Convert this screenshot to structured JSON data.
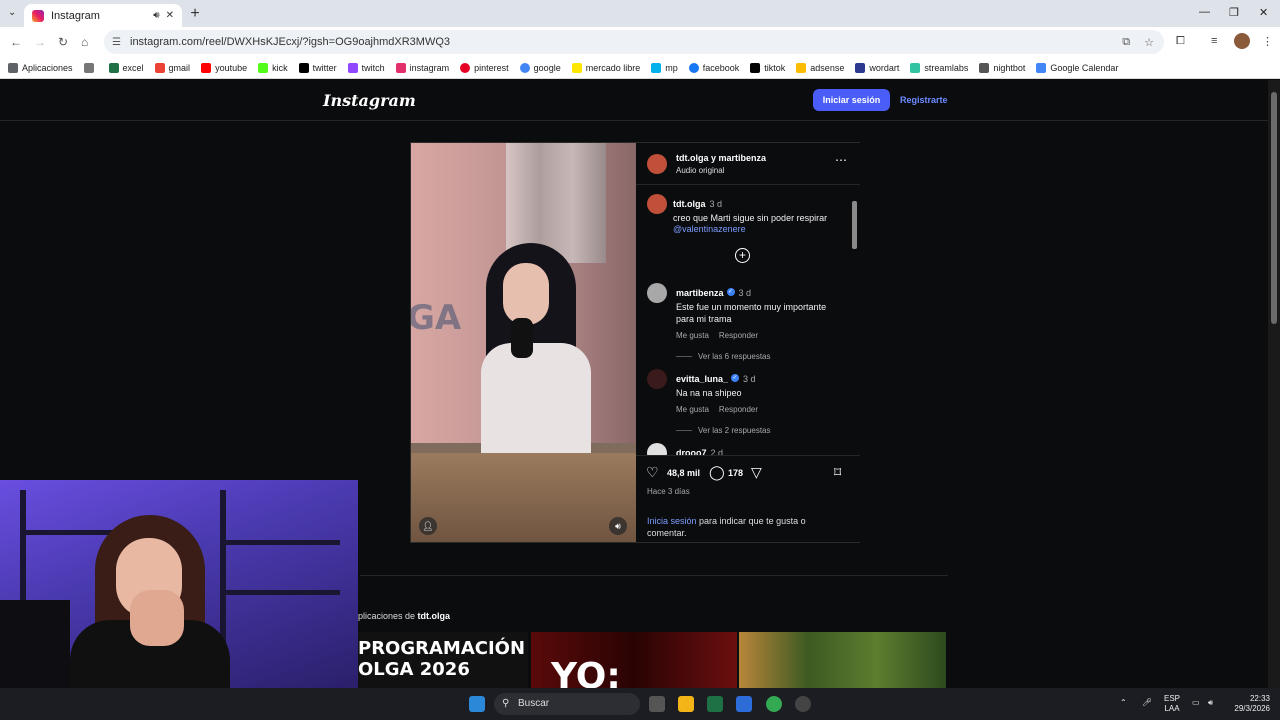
{
  "browser": {
    "tab_title": "Instagram",
    "url": "instagram.com/reel/DWXHsKJEcxj/?igsh=OG9oajhmdXR3MWQ3",
    "bookmarks": [
      {
        "label": "Aplicaciones",
        "color": "#4285f4"
      },
      {
        "label": "excel",
        "color": "#1e7145"
      },
      {
        "label": "gmail",
        "color": "#ea4335"
      },
      {
        "label": "youtube",
        "color": "#ff0000"
      },
      {
        "label": "kick",
        "color": "#53fc18"
      },
      {
        "label": "twitter",
        "color": "#000000"
      },
      {
        "label": "twitch",
        "color": "#9146ff"
      },
      {
        "label": "instagram",
        "color": "#e1306c"
      },
      {
        "label": "pinterest",
        "color": "#e60023"
      },
      {
        "label": "google",
        "color": "#4285f4"
      },
      {
        "label": "mercado libre",
        "color": "#ffe600"
      },
      {
        "label": "mp",
        "color": "#00b1ea"
      },
      {
        "label": "facebook",
        "color": "#1877f2"
      },
      {
        "label": "tiktok",
        "color": "#010101"
      },
      {
        "label": "adsense",
        "color": "#fbbc04"
      },
      {
        "label": "wordart",
        "color": "#2b3a8f"
      },
      {
        "label": "streamlabs",
        "color": "#31c3a2"
      },
      {
        "label": "nightbot",
        "color": "#555555"
      },
      {
        "label": "Google Calendar",
        "color": "#4285f4"
      }
    ]
  },
  "ig": {
    "logo": "Instagram",
    "login_button": "Iniciar sesión",
    "register_link": "Registrarte",
    "post": {
      "authors": "tdt.olga y martibenza",
      "audio": "Audio original",
      "caption": {
        "user": "tdt.olga",
        "time": "3 d",
        "text": "creo que Marti sigue sin poder respirar",
        "mention": "@valentinazenere"
      },
      "comments": [
        {
          "user": "martibenza",
          "time": "3 d",
          "text": "Este fue un momento muy importante para mi trama",
          "like": "Me gusta",
          "reply": "Responder",
          "replies": "Ver las 6 respuestas"
        },
        {
          "user": "evitta_luna_",
          "time": "3 d",
          "text": "Na na na shipeo",
          "like": "Me gusta",
          "reply": "Responder",
          "replies": "Ver las 2 respuestas"
        },
        {
          "user": "drooo7",
          "time": "2 d"
        }
      ],
      "likes": "48,8 mil",
      "comments_count": "178",
      "ago": "Hace 3 días",
      "login_link": "Inicia sesión",
      "login_rest": " para indicar que te gusta o comentar."
    },
    "more_from_prefix": "plicaciones de ",
    "more_from_user": "tdt.olga",
    "thumb1_text": "PROGRAMACIÓN\nOLGA 2026",
    "thumb2_text": "YO:"
  },
  "taskbar": {
    "search": "Buscar",
    "lang_top": "ESP",
    "lang_bottom": "LAA",
    "time": "22:33",
    "date": "29/3/2026"
  }
}
